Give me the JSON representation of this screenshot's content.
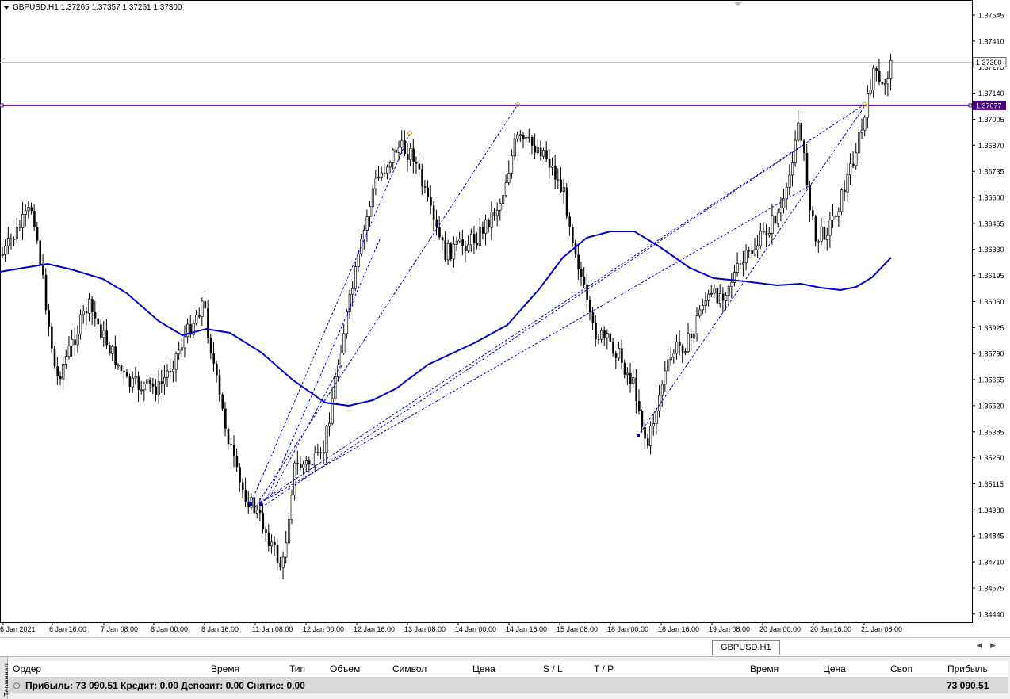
{
  "chart": {
    "symbol_line": "GBPUSD,H1  1.37265 1.37357 1.37261 1.37300",
    "current_price_label": "1.37300",
    "hline_price_label": "1.37077",
    "price_axis_labels": [
      "1.37545",
      "1.37410",
      "1.37275",
      "1.37140",
      "1.37005",
      "1.36870",
      "1.36735",
      "1.36600",
      "1.36465",
      "1.36330",
      "1.36195",
      "1.36060",
      "1.35925",
      "1.35790",
      "1.35655",
      "1.35520",
      "1.35385",
      "1.35250",
      "1.35115",
      "1.34980",
      "1.34845",
      "1.34710",
      "1.34575",
      "1.34440"
    ],
    "time_axis_labels": [
      "6 Jan 2021",
      "6 Jan 16:00",
      "7 Jan 08:00",
      "8 Jan 00:00",
      "8 Jan 16:00",
      "11 Jan 08:00",
      "12 Jan 00:00",
      "12 Jan 16:00",
      "13 Jan 08:00",
      "14 Jan 00:00",
      "14 Jan 16:00",
      "15 Jan 08:00",
      "18 Jan 00:00",
      "18 Jan 16:00",
      "19 Jan 08:00",
      "20 Jan 00:00",
      "20 Jan 16:00",
      "21 Jan 08:00"
    ],
    "colors": {
      "candle": "#000000",
      "moving_average": "#0000cc",
      "hline": "#4b0082",
      "trendline": "#0000cc",
      "grid_price_line": "#c0c0c0"
    }
  },
  "tabs": {
    "symbol_tab": "GBPUSD,H1"
  },
  "terminal": {
    "side_label": "Терминал",
    "headers": {
      "order": "Ордер",
      "time": "Время",
      "type": "Тип",
      "volume": "Объем",
      "symbol": "Символ",
      "price": "Цена",
      "sl": "S / L",
      "tp": "T / P",
      "time2": "Время",
      "price2": "Цена",
      "swap": "Своп",
      "profit": "Прибыль"
    },
    "summary": {
      "text": "Прибыль: 73 090.51  Кредит: 0.00  Депозит: 0.00  Снятие: 0.00",
      "total": "73 090.51"
    }
  }
}
